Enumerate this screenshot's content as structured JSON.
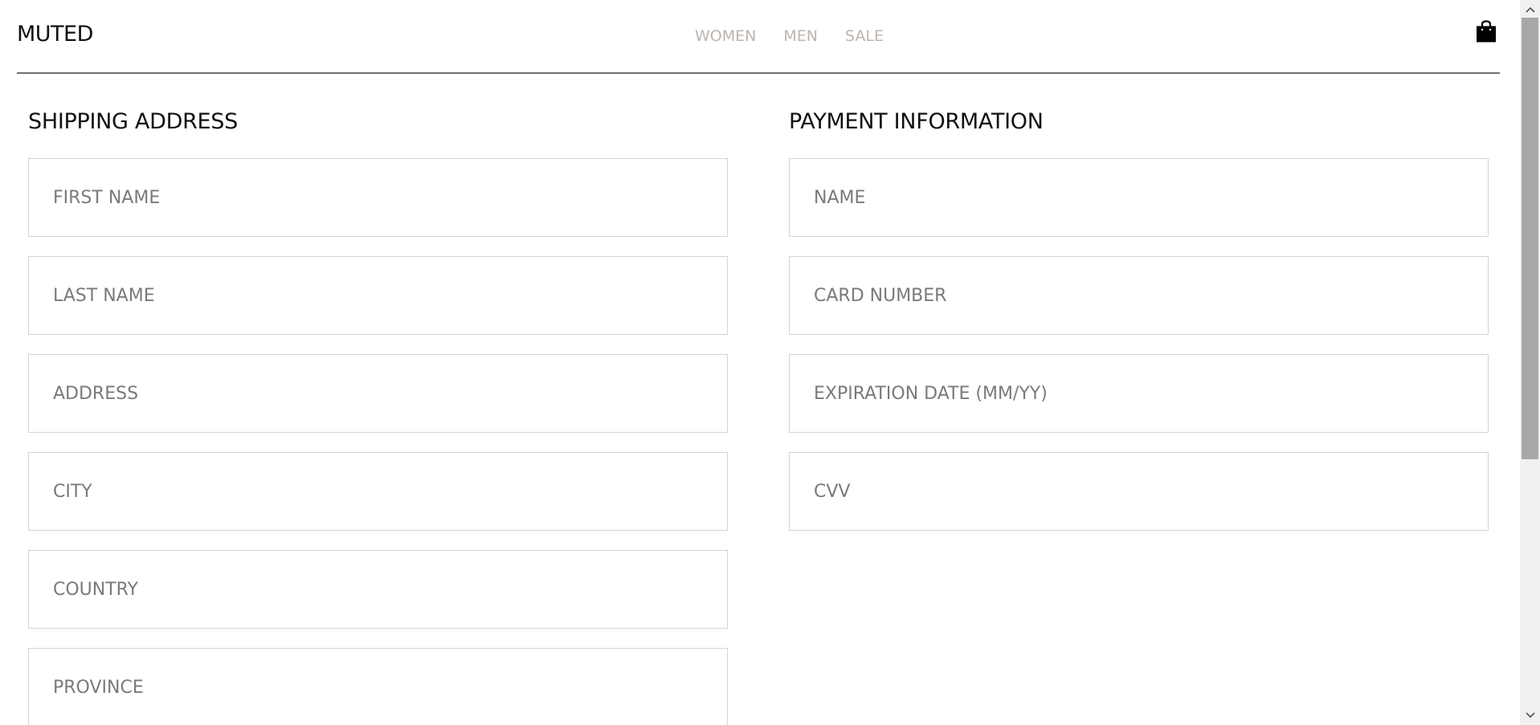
{
  "brand": {
    "logo": "MUTED"
  },
  "nav": {
    "items": [
      {
        "label": "WOMEN"
      },
      {
        "label": "MEN"
      },
      {
        "label": "SALE"
      }
    ],
    "color": "#bdb5ad"
  },
  "cart": {
    "icon": "shopping-bag-icon"
  },
  "shipping": {
    "title": "SHIPPING ADDRESS",
    "fields": [
      {
        "placeholder": "FIRST NAME",
        "value": ""
      },
      {
        "placeholder": "LAST NAME",
        "value": ""
      },
      {
        "placeholder": "ADDRESS",
        "value": ""
      },
      {
        "placeholder": "CITY",
        "value": ""
      },
      {
        "placeholder": "COUNTRY",
        "value": ""
      },
      {
        "placeholder": "PROVINCE",
        "value": ""
      }
    ]
  },
  "payment": {
    "title": "PAYMENT INFORMATION",
    "fields": [
      {
        "placeholder": "NAME",
        "value": ""
      },
      {
        "placeholder": "CARD NUMBER",
        "value": ""
      },
      {
        "placeholder": "EXPIRATION DATE (MM/YY)",
        "value": ""
      },
      {
        "placeholder": "CVV",
        "value": ""
      }
    ]
  },
  "scrollbar": {
    "up_icon": "chevron-up-icon",
    "down_icon": "chevron-down-icon"
  }
}
